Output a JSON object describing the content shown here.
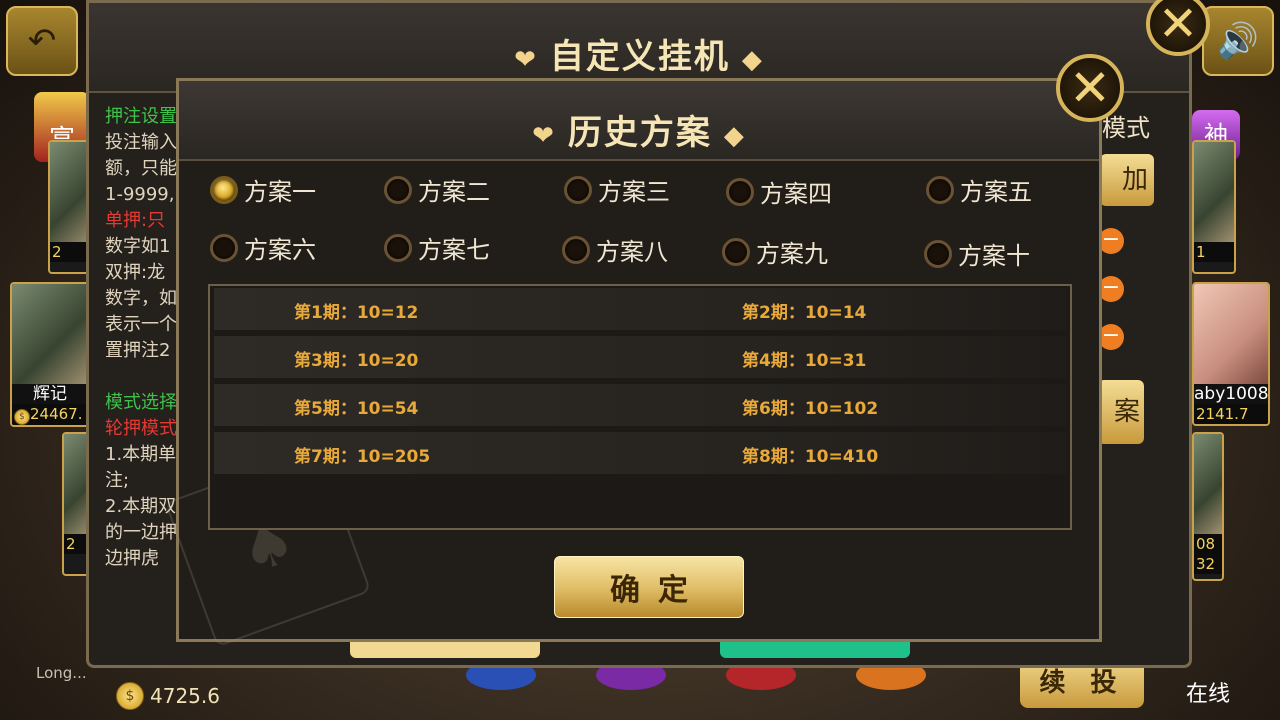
{
  "background": {
    "back_icon": "back-arrow-icon",
    "sound_icon": "speaker-icon",
    "players": [
      {
        "name": "辉记",
        "coins": "24467."
      },
      {
        "name": "aby1008",
        "coins": "2141.7"
      }
    ],
    "badge_left": "富",
    "badge_right": "袖",
    "bottom_user": "Long...",
    "bottom_coins": "4725.6",
    "continue_label": "续 投",
    "online_label": "在线",
    "side_right_values": [
      "1",
      "08",
      "32"
    ],
    "left_small_coin": "2",
    "left_coin2": "2"
  },
  "outer_dialog": {
    "title": "自定义挂机",
    "mode_label": "模式",
    "add_label": "加",
    "plan_label": "案",
    "left_lines": [
      {
        "text": "押注设置",
        "color": "g"
      },
      {
        "text": "投注输入",
        "color": ""
      },
      {
        "text": "额，只能",
        "color": ""
      },
      {
        "text": "1-9999,",
        "color": ""
      },
      {
        "text": "单押:只",
        "color": "r"
      },
      {
        "text": "数字如1",
        "color": ""
      },
      {
        "text": "双押:龙",
        "color": ""
      },
      {
        "text": "数字，如",
        "color": ""
      },
      {
        "text": "表示一个",
        "color": ""
      },
      {
        "text": "置押注2",
        "color": ""
      },
      {
        "text": "",
        "color": ""
      },
      {
        "text": "模式选择",
        "color": "g"
      },
      {
        "text": "轮押模式",
        "color": "r"
      },
      {
        "text": "1.本期单",
        "color": ""
      },
      {
        "text": "注;",
        "color": ""
      },
      {
        "text": "2.本期双",
        "color": ""
      },
      {
        "text": "的一边押",
        "color": ""
      },
      {
        "text": "边押虎",
        "color": ""
      }
    ]
  },
  "inner_dialog": {
    "title": "历史方案",
    "plans": [
      {
        "label": "方案一",
        "selected": true
      },
      {
        "label": "方案二",
        "selected": false
      },
      {
        "label": "方案三",
        "selected": false
      },
      {
        "label": "方案四",
        "selected": false
      },
      {
        "label": "方案五",
        "selected": false
      },
      {
        "label": "方案六",
        "selected": false
      },
      {
        "label": "方案七",
        "selected": false
      },
      {
        "label": "方案八",
        "selected": false
      },
      {
        "label": "方案九",
        "selected": false
      },
      {
        "label": "方案十",
        "selected": false
      }
    ],
    "records": [
      "第1期：10=12",
      "第2期：10=14",
      "第3期：10=20",
      "第4期：10=31",
      "第5期：10=54",
      "第6期：10=102",
      "第7期：10=205",
      "第8期：10=410"
    ],
    "confirm_label": "确定"
  }
}
